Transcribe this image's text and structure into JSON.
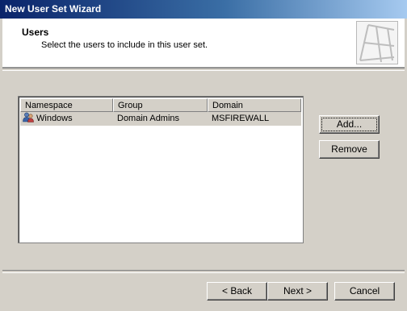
{
  "window": {
    "title": "New User Set Wizard"
  },
  "header": {
    "title": "Users",
    "subtitle": "Select the users to include in this user set.",
    "icon": "wizard-banner-icon"
  },
  "list": {
    "columns": [
      "Namespace",
      "Group",
      "Domain"
    ],
    "rows": [
      {
        "namespace": "Windows",
        "group": "Domain Admins",
        "domain": "MSFIREWALL",
        "icon": "user-group-icon",
        "selected": true
      }
    ]
  },
  "side_buttons": {
    "add": "Add...",
    "remove": "Remove"
  },
  "footer_buttons": {
    "back": "< Back",
    "next": "Next >",
    "cancel": "Cancel"
  }
}
